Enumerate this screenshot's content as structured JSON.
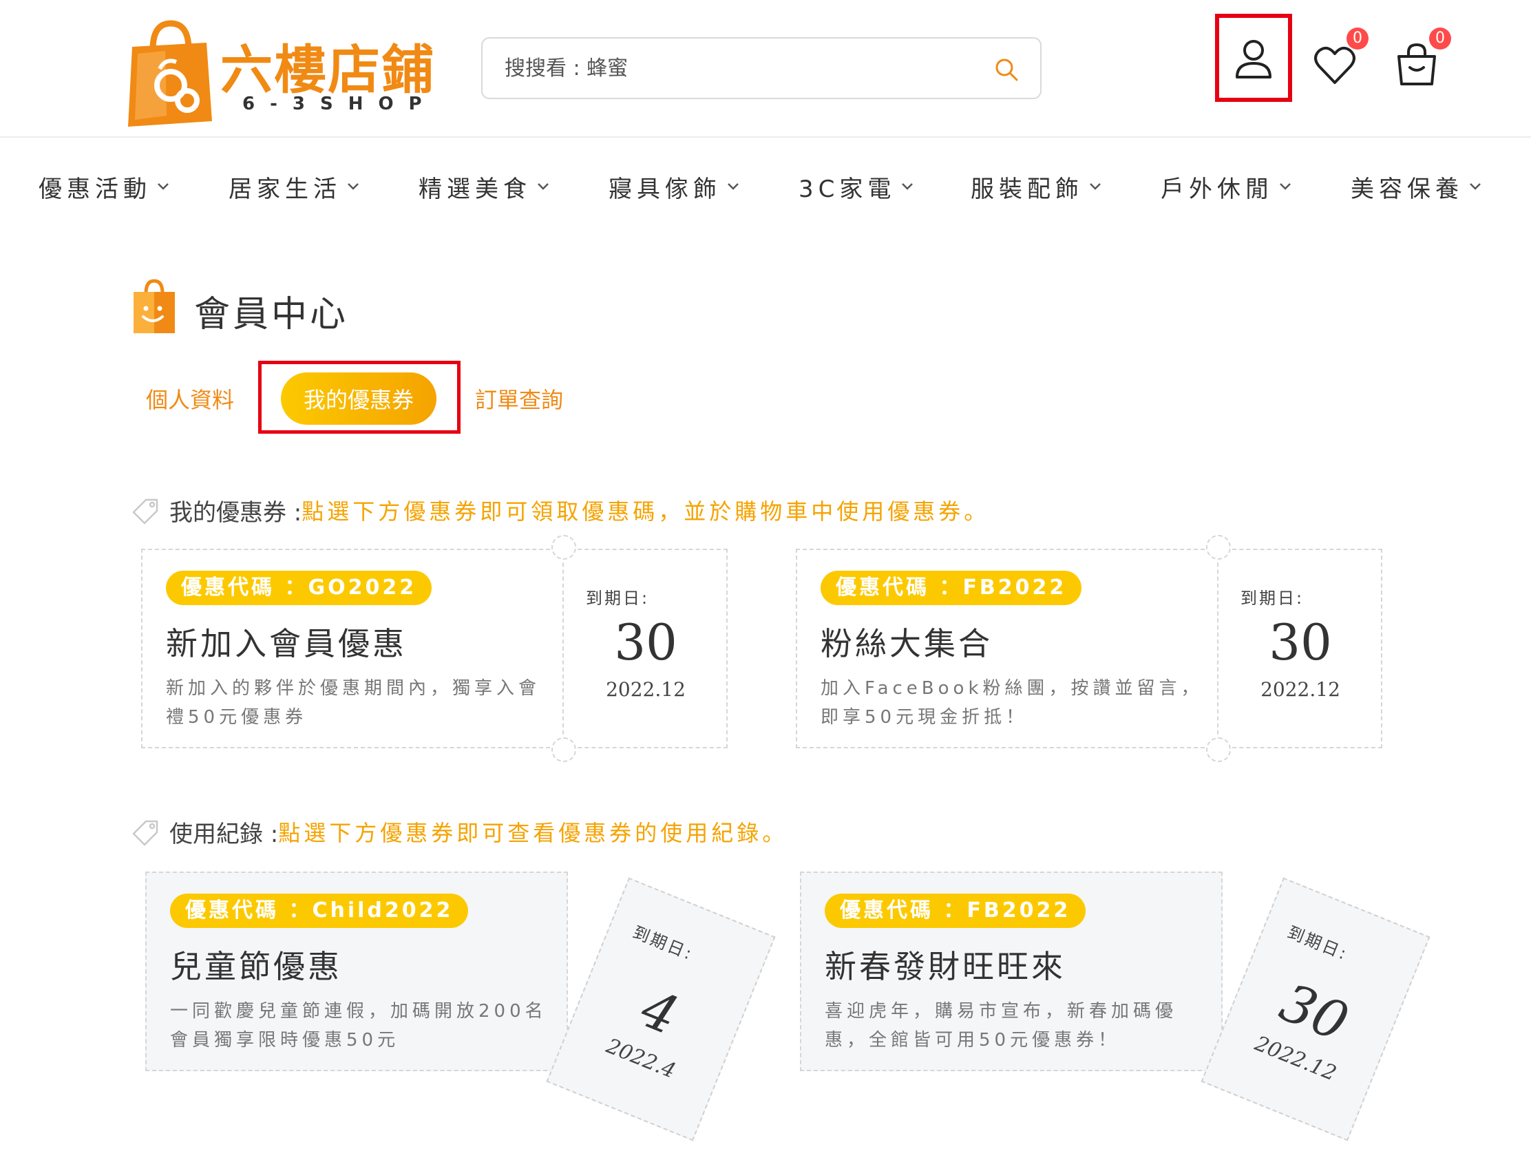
{
  "colors": {
    "brand_orange": "#f08a14",
    "coupon_yellow": "#fcc900",
    "highlight_red": "#e60012",
    "badge_red": "#ff4a4a"
  },
  "header": {
    "logo_title": "六樓店鋪",
    "logo_sub": "6-3SHOP",
    "search_placeholder": "搜搜看 : 蜂蜜",
    "wishlist_count": "0",
    "cart_count": "0"
  },
  "nav": {
    "items": [
      {
        "label": "優惠活動"
      },
      {
        "label": "居家生活"
      },
      {
        "label": "精選美食"
      },
      {
        "label": "寢具傢飾"
      },
      {
        "label": "3C家電"
      },
      {
        "label": "服裝配飾"
      },
      {
        "label": "戶外休閒"
      },
      {
        "label": "美容保養"
      }
    ]
  },
  "member": {
    "title": "會員中心",
    "tabs": [
      {
        "label": "個人資料"
      },
      {
        "label": "我的優惠券"
      },
      {
        "label": "訂單查詢"
      }
    ]
  },
  "my_coupons": {
    "label": "我的優惠券 :",
    "description": "點選下方優惠券即可領取優惠碼，並於購物車中使用優惠券。",
    "items": [
      {
        "code": "優惠代碼 ：GO2022",
        "title": "新加入會員優惠",
        "desc": "新加入的夥伴於優惠期間內，獨享入會禮50元優惠券",
        "expiry_label": "到期日:",
        "day": "30",
        "year_month": "2022.12"
      },
      {
        "code": "優惠代碼 ：FB2022",
        "title": "粉絲大集合",
        "desc": "加入FaceBook粉絲團，按讚並留言，即享50元現金折抵！",
        "expiry_label": "到期日:",
        "day": "30",
        "year_month": "2022.12"
      }
    ]
  },
  "usage_history": {
    "label": "使用紀錄 :",
    "description": "點選下方優惠券即可查看優惠券的使用紀錄。",
    "items": [
      {
        "code": "優惠代碼 ：Child2022",
        "title": "兒童節優惠",
        "desc": "一同歡慶兒童節連假，加碼開放200名會員獨享限時優惠50元",
        "expiry_label": "到期日:",
        "day": "4",
        "year_month": "2022.4"
      },
      {
        "code": "優惠代碼 ：FB2022",
        "title": "新春發財旺旺來",
        "desc": "喜迎虎年，購易市宣布，新春加碼優惠，全館皆可用50元優惠券！",
        "expiry_label": "到期日:",
        "day": "30",
        "year_month": "2022.12"
      }
    ]
  }
}
